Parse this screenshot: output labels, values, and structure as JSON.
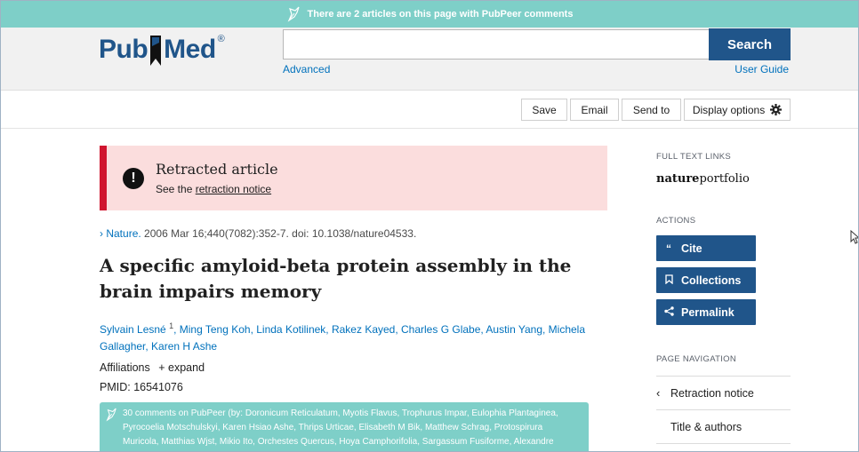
{
  "pubpeer_banner": "There are 2 articles on this page with PubPeer comments",
  "logo": {
    "part1": "Pub",
    "part2": "Med",
    "reg": "®"
  },
  "search": {
    "placeholder": "",
    "button": "Search",
    "advanced": "Advanced",
    "guide": "User Guide"
  },
  "toolbar": {
    "save": "Save",
    "email": "Email",
    "send_to": "Send to",
    "display_options": "Display options"
  },
  "retraction": {
    "title": "Retracted article",
    "prefix": "See the",
    "link": "retraction notice"
  },
  "citation": {
    "journal": "Nature.",
    "details": "2006 Mar 16;440(7082):352-7. doi: 10.1038/nature04533."
  },
  "article_title": "A specific amyloid-beta protein assembly in the brain impairs memory",
  "authors": {
    "first": "Sylvain Lesné",
    "first_sup": "1",
    "rest": ", Ming Teng Koh, Linda Kotilinek, Rakez Kayed, Charles G Glabe, Austin Yang, Michela Gallagher, Karen H Ashe"
  },
  "affiliations": {
    "label": "Affiliations",
    "expand": "+ expand"
  },
  "pmid": "PMID: 16541076",
  "pubpeer_comments": "30 comments on PubPeer (by: Doronicum Reticulatum, Myotis Flavus, Trophurus Impar, Eulophia Plantaginea, Pyrocoelia Motschulskyi, Karen Hsiao Ashe, Thrips Urticae, Elisabeth M Bik, Matthew Schrag, Protospirura Muricola, Matthias Wjst, Mikio Ito, Orchestes Quercus, Hoya Camphorifolia, Sargassum Fusiforme, Alexandre",
  "sidebar": {
    "full_text_label": "FULL TEXT LINKS",
    "nature_bold": "nature",
    "nature_light": "portfolio",
    "actions_label": "ACTIONS",
    "cite": "Cite",
    "collections": "Collections",
    "permalink": "Permalink",
    "page_nav_label": "PAGE NAVIGATION",
    "nav_items": [
      "Retraction notice",
      "Title & authors"
    ]
  },
  "colors": {
    "brand": "#20558a",
    "pubpeer": "#7ecfc8",
    "retract_bg": "#fbdddd",
    "retract_bar": "#d0152f",
    "link": "#0071bc"
  }
}
